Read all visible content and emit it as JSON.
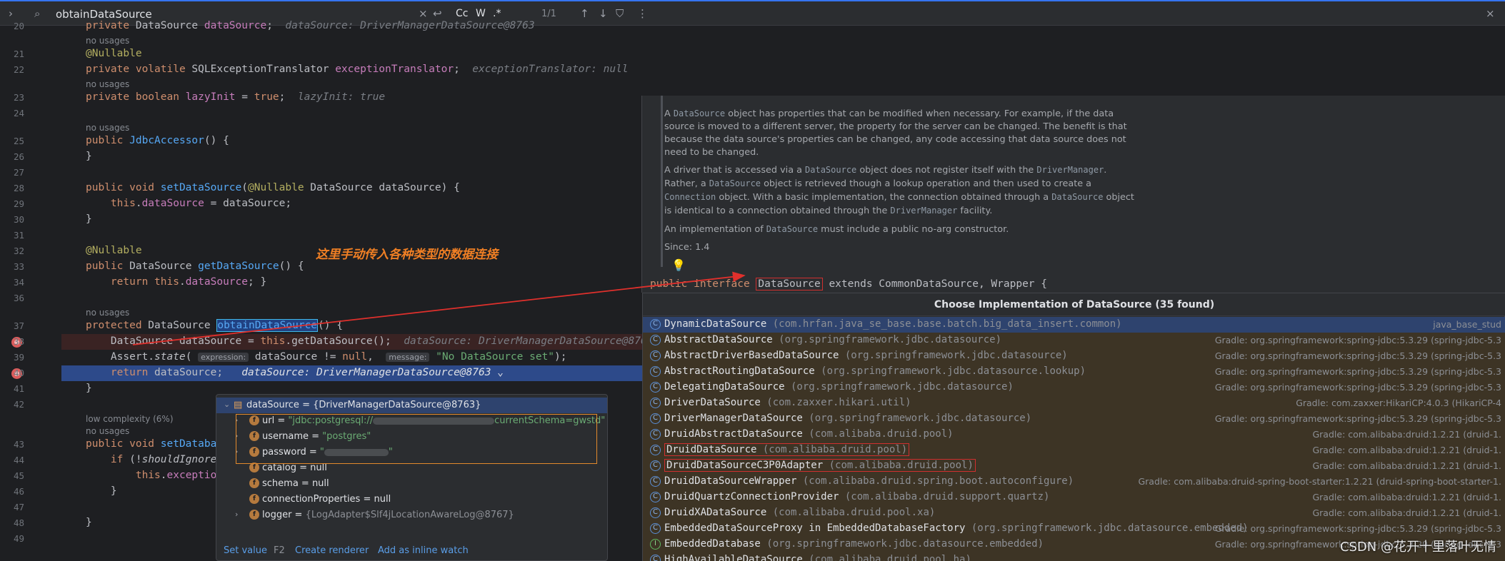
{
  "search": {
    "value": "obtainDataSource",
    "match_count": "1/1",
    "options": [
      "Cc",
      "W",
      ".*"
    ]
  },
  "editor": {
    "lines": [
      {
        "num": "20",
        "html": "<span class='kw'>private</span> DataSource <span class='fld'>dataSource</span>;  <span class='inl'>dataSource: DriverManagerDataSource@8763</span>"
      },
      {
        "hint": "no usages"
      },
      {
        "num": "21",
        "html": "<span class='ann'>@Nullable</span>"
      },
      {
        "num": "22",
        "html": "<span class='kw'>private volatile</span> SQLExceptionTranslator <span class='fld'>exceptionTranslator</span>;  <span class='inl'>exceptionTranslator: null</span>"
      },
      {
        "hint": "no usages"
      },
      {
        "num": "23",
        "html": "<span class='kw'>private boolean</span> <span class='fld'>lazyInit</span> = <span class='kw'>true</span>;  <span class='inl'>lazyInit: true</span>"
      },
      {
        "num": "24",
        "html": ""
      },
      {
        "hint": "no usages"
      },
      {
        "num": "25",
        "html": "<span class='kw'>public</span> <span class='fn'>JdbcAccessor</span>() {"
      },
      {
        "num": "26",
        "html": "}"
      },
      {
        "num": "27",
        "html": ""
      },
      {
        "num": "28",
        "html": "<span class='kw'>public void</span> <span class='fn'>setDataSource</span>(<span class='ann'>@Nullable</span> DataSource dataSource) {"
      },
      {
        "num": "29",
        "html": "    <span class='kw'>this</span>.<span class='fld'>dataSource</span> = dataSource;"
      },
      {
        "num": "30",
        "html": "}"
      },
      {
        "num": "31",
        "html": ""
      },
      {
        "num": "32",
        "html": "<span class='ann'>@Nullable</span>"
      },
      {
        "num": "33",
        "html": "<span class='kw'>public</span> DataSource <span class='fn'>getDataSource</span>() {"
      },
      {
        "num": "34",
        "html": "    <span class='kw'>return this</span>.<span class='fld'>dataSource</span>; }"
      },
      {
        "num": "36",
        "html": ""
      },
      {
        "hint": "no usages"
      },
      {
        "num": "37",
        "html": "<span class='kw'>protected</span> DataSource <span class='fn sel-word'>obtainDataSource</span>() {"
      },
      {
        "num": "38",
        "html": "    DataSource dataSource = <span class='kw'>this</span>.getDataSource();  <span class='inl'>dataSource: DriverManagerDataSource@8763</span>"
      },
      {
        "num": "39",
        "html": "    Assert.<span class='it'>state</span>( <span class='param-hint'>expression:</span> dataSource != <span class='kw'>null</span>,  <span class='param-hint'>message:</span> <span class='str'>\"No DataSource set\"</span>);"
      },
      {
        "num": "40",
        "html": "    <span class='kw'>return</span> dataSource;   <span class='inl' style='color:#dfe1e5'>dataSource: DriverManagerDataSource@8763 ⌄</span>"
      },
      {
        "num": "41",
        "html": "}"
      },
      {
        "num": "42",
        "html": ""
      },
      {
        "hint": "low complexity (6%)"
      },
      {
        "hint": "no usages"
      },
      {
        "num": "43",
        "html": "<span class='kw'>public void</span> <span class='fn'>setDatabase</span>"
      },
      {
        "num": "44",
        "html": "    <span class='kw'>if</span> (!<span class='it'>shouldIgnoreXm</span>"
      },
      {
        "num": "45",
        "html": "        <span class='kw'>this</span>.<span class='fld'>exceptionT</span>"
      },
      {
        "num": "46",
        "html": "    }"
      },
      {
        "num": "47",
        "html": ""
      },
      {
        "num": "48",
        "html": "}"
      },
      {
        "num": "49",
        "html": ""
      }
    ]
  },
  "annotation": "这里手动传入各种类型的数据连接",
  "doc": {
    "paragraphs": [
      "A <span class='mono'>DataSource</span> object has properties that can be modified when necessary. For example, if the data source is moved to a different server, the property for the server can be changed. The benefit is that because the data source's properties can be changed, any code accessing that data source does not need to be changed.",
      "A driver that is accessed via a <span class='mono'>DataSource</span> object does not register itself with the <span class='mono'>DriverManager</span>. Rather, a <span class='mono'>DataSource</span> object is retrieved though a lookup operation and then used to create a <span class='mono'>Connection</span> object. With a basic implementation, the connection obtained through a <span class='mono'>DataSource</span> object is identical to a connection obtained through the <span class='mono'>DriverManager</span> facility.",
      "An implementation of <span class='mono'>DataSource</span> must include a public no-arg constructor."
    ],
    "since": "Since: 1.4",
    "decl_pre": "public interface ",
    "decl_name": "DataSource",
    "decl_post": " extends CommonDataSource, Wrapper {"
  },
  "chooser": {
    "title": "Choose Implementation of DataSource (35 found)",
    "options": [
      {
        "name": "DynamicDataSource",
        "pkg": "(com.hrfan.java_se_base.base.batch.big_data_insert.common)",
        "loc": "java_base_stud",
        "selected": true
      },
      {
        "name": "AbstractDataSource",
        "pkg": "(org.springframework.jdbc.datasource)",
        "loc": "Gradle: org.springframework:spring-jdbc:5.3.29 (spring-jdbc-5.3"
      },
      {
        "name": "AbstractDriverBasedDataSource",
        "pkg": "(org.springframework.jdbc.datasource)",
        "loc": "Gradle: org.springframework:spring-jdbc:5.3.29 (spring-jdbc-5.3"
      },
      {
        "name": "AbstractRoutingDataSource",
        "pkg": "(org.springframework.jdbc.datasource.lookup)",
        "loc": "Gradle: org.springframework:spring-jdbc:5.3.29 (spring-jdbc-5.3"
      },
      {
        "name": "DelegatingDataSource",
        "pkg": "(org.springframework.jdbc.datasource)",
        "loc": "Gradle: org.springframework:spring-jdbc:5.3.29 (spring-jdbc-5.3"
      },
      {
        "name": "DriverDataSource",
        "pkg": "(com.zaxxer.hikari.util)",
        "loc": "Gradle: com.zaxxer:HikariCP:4.0.3 (HikariCP-4"
      },
      {
        "name": "DriverManagerDataSource",
        "pkg": "(org.springframework.jdbc.datasource)",
        "loc": "Gradle: org.springframework:spring-jdbc:5.3.29 (spring-jdbc-5.3"
      },
      {
        "name": "DruidAbstractDataSource",
        "pkg": "(com.alibaba.druid.pool)",
        "loc": "Gradle: com.alibaba:druid:1.2.21 (druid-1."
      },
      {
        "name": "DruidDataSource",
        "pkg": "(com.alibaba.druid.pool)",
        "loc": "Gradle: com.alibaba:druid:1.2.21 (druid-1.",
        "boxed": true
      },
      {
        "name": "DruidDataSourceC3P0Adapter",
        "pkg": "(com.alibaba.druid.pool)",
        "loc": "Gradle: com.alibaba:druid:1.2.21 (druid-1.",
        "boxed": true
      },
      {
        "name": "DruidDataSourceWrapper",
        "pkg": "(com.alibaba.druid.spring.boot.autoconfigure)",
        "loc": "Gradle: com.alibaba:druid-spring-boot-starter:1.2.21 (druid-spring-boot-starter-1."
      },
      {
        "name": "DruidQuartzConnectionProvider",
        "pkg": "(com.alibaba.druid.support.quartz)",
        "loc": "Gradle: com.alibaba:druid:1.2.21 (druid-1."
      },
      {
        "name": "DruidXADataSource",
        "pkg": "(com.alibaba.druid.pool.xa)",
        "loc": "Gradle: com.alibaba:druid:1.2.21 (druid-1."
      },
      {
        "name": "EmbeddedDataSourceProxy in EmbeddedDatabaseFactory",
        "pkg": "(org.springframework.jdbc.datasource.embedded)",
        "loc": "Gradle: org.springframework:spring-jdbc:5.3.29 (spring-jdbc-5.3"
      },
      {
        "name": "EmbeddedDatabase",
        "pkg": "(org.springframework.jdbc.datasource.embedded)",
        "loc": "Gradle: org.springframework:spring-jdbc:5.3.29 (spring-jdbc-5.3",
        "icon": "I"
      },
      {
        "name": "HighAvailableDataSource",
        "pkg": "(com.alibaba.druid.pool.ha)",
        "loc": ""
      }
    ]
  },
  "debugger": {
    "root": "dataSource = {DriverManagerDataSource@8763}",
    "fields": [
      {
        "name": "url",
        "value": "\"jdbc:postgresql://",
        "tail": "currentSchema=gwstd\"",
        "blur": true,
        "expand": true
      },
      {
        "name": "username",
        "value": "\"postgres\"",
        "expand": true
      },
      {
        "name": "password",
        "value": "\"",
        "tail": "\"",
        "blur": true,
        "short": true,
        "expand": true
      },
      {
        "name": "catalog",
        "value": "null"
      },
      {
        "name": "schema",
        "value": "null"
      },
      {
        "name": "connectionProperties",
        "value": "null"
      },
      {
        "name": "logger",
        "value": "{LogAdapter$Slf4jLocationAwareLog@8767}",
        "dim": true,
        "expand": true
      }
    ],
    "footer": {
      "set_value": "Set value",
      "set_value_key": "F2",
      "create_renderer": "Create renderer",
      "add_inline": "Add as inline watch"
    }
  },
  "watermark": "CSDN @花开十里落叶无情",
  "colors": {
    "accent": "#3574f0",
    "error_bg": "#3a2323",
    "exec_bg": "#2d4a8a",
    "annotation": "#f07f24",
    "red_box": "#d0302f"
  }
}
